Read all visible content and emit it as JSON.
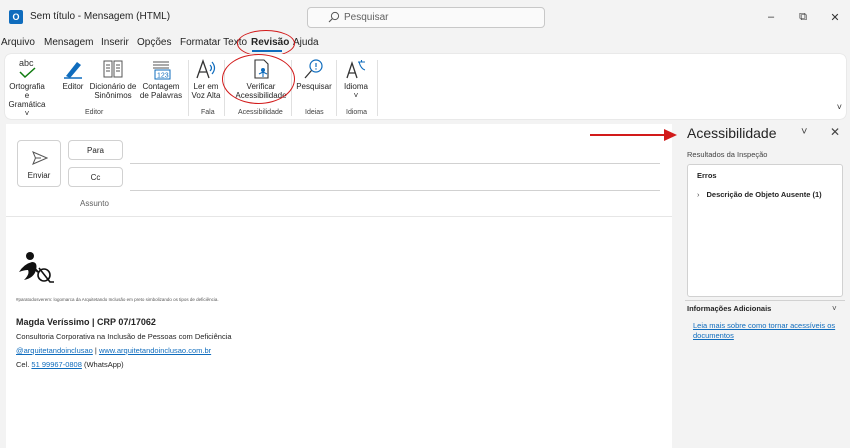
{
  "window": {
    "title": "Sem título  -  Mensagem (HTML)",
    "search_placeholder": "Pesquisar",
    "minimize": "–",
    "restore": "⧉",
    "close": "✕"
  },
  "menu": {
    "tabs": [
      "Arquivo",
      "Mensagem",
      "Inserir",
      "Opções",
      "Formatar Texto",
      "Revisão",
      "Ajuda"
    ],
    "active_tab": "Revisão"
  },
  "ribbon": {
    "buttons": {
      "ortografia": "Ortografia e Gramática ˅",
      "editor": "Editor",
      "dicionario": "Dicionário de Sinônimos",
      "contagem": "Contagem de Palavras",
      "ler_voz": "Ler em Voz Alta",
      "verificar": "Verificar Acessibilidade",
      "pesquisar": "Pesquisar",
      "idioma": "Idioma",
      "idioma_chevron": "˅"
    },
    "groups": [
      "Editor",
      "Fala",
      "Acessibilidade",
      "Ideias",
      "Idioma"
    ],
    "collapse": "˅",
    "abc_text": "abc",
    "count_text": "123"
  },
  "compose": {
    "send_label": "Enviar",
    "to_label": "Para",
    "cc_label": "Cc",
    "subject_label": "Assunto",
    "signature": {
      "small_text": "#paratodosverem: logomarca da Arquitetando Inclusão em preto simbolizando os tipos de deficiência.",
      "name": "Magda Veríssimo | CRP 07/17062",
      "company": "Consultoria Corporativa na Inclusão de Pessoas com Deficiência",
      "link1": "@arquitetandoinclusao",
      "pipe": " | ",
      "link2": "www.arquitetandoinclusao.com.br",
      "phone_prefix": "Cel. ",
      "phone": "51 99967-0808",
      "phone_suffix": " (WhatsApp)"
    }
  },
  "pane": {
    "title": "Acessibilidade",
    "subtitle": "Resultados da Inspeção",
    "errors_header": "Erros",
    "error_item": "Descrição de Objeto Ausente (1)",
    "additional_info": "Informações Adicionais",
    "link": "Leia mais sobre como tornar acessíveis os documentos",
    "chevron": "˅",
    "close": "✕",
    "item_chevron": "›"
  },
  "colors": {
    "accent": "#0f6cbd",
    "highlight": "#d21a1a"
  }
}
